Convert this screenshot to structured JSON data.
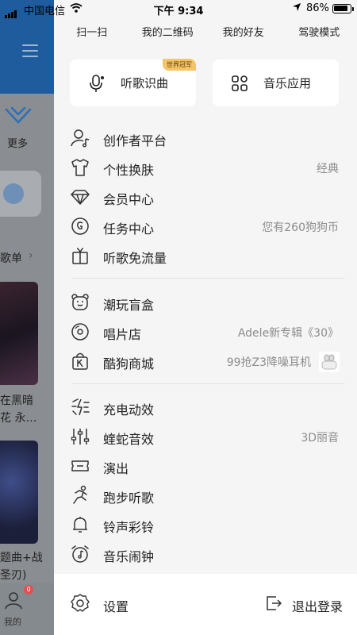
{
  "status_bar": {
    "carrier": "中国电信",
    "time": "下午 9:34",
    "battery": "86%"
  },
  "background": {
    "more_label": "更多",
    "playlist_label": "歌单",
    "tile1_line1": "在黑暗",
    "tile1_line2": "花 永…",
    "tile2_line1": "题曲+战",
    "tile2_line2": "圣刃)",
    "tab_me_label": "我的",
    "badge_count": "0"
  },
  "top_links": [
    "扫一扫",
    "我的二维码",
    "我的好友",
    "驾驶模式"
  ],
  "cards": {
    "recognize": {
      "label": "听歌识曲",
      "badge": "世界冠军",
      "icon": "mic-note-icon"
    },
    "apps": {
      "label": "音乐应用",
      "icon": "grid-apps-icon"
    }
  },
  "menu_group1": [
    {
      "label": "创作者平台",
      "value": "",
      "icon": "creator-icon"
    },
    {
      "label": "个性换肤",
      "value": "经典",
      "icon": "tshirt-icon"
    },
    {
      "label": "会员中心",
      "value": "",
      "icon": "diamond-icon"
    },
    {
      "label": "任务中心",
      "value": "您有260狗狗币",
      "icon": "coin-icon"
    },
    {
      "label": "听歌免流量",
      "value": "",
      "icon": "gift-icon"
    }
  ],
  "menu_group2": [
    {
      "label": "潮玩盲盒",
      "value": "",
      "icon": "bear-icon"
    },
    {
      "label": "唱片店",
      "value": "Adele新专辑《30》",
      "icon": "disc-icon"
    },
    {
      "label": "酷狗商城",
      "value": "99抢Z3降噪耳机",
      "icon": "shop-bag-icon"
    }
  ],
  "menu_group3": [
    {
      "label": "充电动效",
      "value": "",
      "icon": "charge-icon"
    },
    {
      "label": "蝰蛇音效",
      "value": "3D丽音",
      "icon": "equalizer-icon"
    },
    {
      "label": "演出",
      "value": "",
      "icon": "ticket-icon"
    },
    {
      "label": "跑步听歌",
      "value": "",
      "icon": "running-icon"
    },
    {
      "label": "铃声彩铃",
      "value": "",
      "icon": "bell-icon"
    },
    {
      "label": "音乐闹钟",
      "value": "",
      "icon": "alarm-clock-icon"
    }
  ],
  "bottom": {
    "settings": "设置",
    "logout": "退出登录"
  },
  "colors": {
    "drawer_bg": "#f5f5f5",
    "badge_gold": "#f3c566",
    "muted_text": "#8c8c8c"
  }
}
